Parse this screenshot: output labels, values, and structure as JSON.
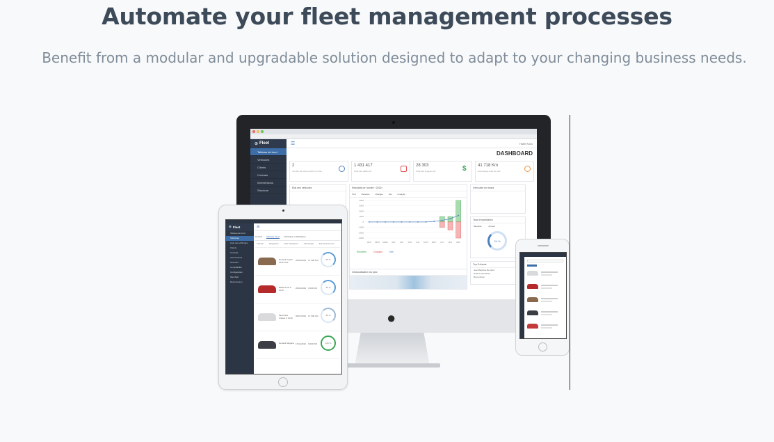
{
  "hero": {
    "title": "Automate your fleet management processes",
    "subtitle": "Benefit from a modular and upgradable solution designed to adapt to your changing business needs."
  },
  "desktop_app": {
    "logo": "Fleet",
    "page_title": "DASHBOARD",
    "user": "Hatte Karo",
    "sidebar": [
      "Tableau de bord",
      "Véhicules",
      "Clients",
      "Contrats",
      "Interventions",
      "Structure"
    ],
    "kpis": [
      {
        "value": "2",
        "label": "nombre de clients actifs ce mois",
        "icon": "users-icon",
        "color": "#4d7fbf"
      },
      {
        "value": "1 431 417",
        "label": "Total des débits HT",
        "icon": "card-icon",
        "color": "#e05252"
      },
      {
        "value": "28 303",
        "label": "Total des impayés HT",
        "icon": "dollar-icon",
        "color": "#3aa655"
      },
      {
        "value": "41 718 Km",
        "label": "kilométrage total du parc",
        "icon": "gauge-icon",
        "color": "#f0913a"
      }
    ],
    "panels": {
      "vehicle_state": "État des véhicules",
      "results": "Résultats de l'année",
      "returns": "Véhicules en retard",
      "occupancy": "Taux d'exploitation",
      "map": "Géolocalisation du parc",
      "top_clients": "Top 5 clients"
    },
    "results_tabs": [
      "Tout",
      "Recettes",
      "Charges",
      "Net",
      "Impayés"
    ],
    "results_year": "2016",
    "summary": [
      {
        "label": "Recettes",
        "color": "#3aa655"
      },
      {
        "label": "Charges",
        "color": "#e05252"
      },
      {
        "label": "Net",
        "color": "#4d7fbf"
      }
    ],
    "occupancy_value": "24 %",
    "occupancy_tabs": [
      "Mensuel",
      "Annuel"
    ],
    "top_clients": [
      "Jean-Baptiste Bernard",
      "Noël Goulet-Rose",
      "Bryce Morin"
    ]
  },
  "tablet_app": {
    "logo": "Fleet",
    "tabs": [
      "Contrat",
      "Véhicule loués",
      "Véhicules et Statistique"
    ],
    "sidebar": [
      "Tableau de bord",
      "Véhicules",
      "Liste des véhicules",
      "Clients",
      "Contrats",
      "Interventions",
      "Structure",
      "Comptabilité",
      "Configuration",
      "Site Web",
      "Déconnexion"
    ],
    "columns": [
      "Véhicule",
      "Désignation",
      "Date d'acquisition",
      "Kilométrage",
      "Etat d'avancement"
    ],
    "rows": [
      {
        "name": "Renault Captur 2019 TCE",
        "date": "20/03/2016",
        "km": "37 000 KM",
        "pct": "66 %",
        "car_color": "#8a6a4f",
        "ring_color": "#5b9bd5"
      },
      {
        "name": "BMW Série 5 2019",
        "date": "20/04/2016",
        "km": "3 000 KM",
        "pct": "55 %",
        "car_color": "#b52a2a",
        "ring_color": "#5b9bd5"
      },
      {
        "name": "Mercedes Classe C 2019",
        "date": "06/07/2016",
        "km": "27 000 KM",
        "pct": "35 %",
        "car_color": "#d9dadc",
        "ring_color": "#9bb8d6"
      },
      {
        "name": "Renault Mégane",
        "date": "17/11/2016",
        "km": "9 000 KM",
        "pct": "100 %",
        "car_color": "#3b3f45",
        "ring_color": "#3aa655"
      }
    ]
  },
  "phone_app": {
    "rows": [
      {
        "car_color": "#d9dadc"
      },
      {
        "car_color": "#b52a2a"
      },
      {
        "car_color": "#8a6a4f"
      },
      {
        "car_color": "#3b3f45"
      },
      {
        "car_color": "#c23a3a"
      }
    ]
  },
  "chart_data": {
    "type": "bar",
    "title": "Résultats de l'année",
    "categories": [
      "JANV",
      "FÉVR",
      "MARS",
      "AVR",
      "MAI",
      "JUIN",
      "JUIL",
      "AOÛT",
      "SEPT",
      "OCT",
      "NOV",
      "DÉC"
    ],
    "series": [
      {
        "name": "Recettes",
        "values": [
          0,
          0,
          0,
          0,
          0,
          0,
          0,
          0,
          0,
          1000,
          1000,
          4000
        ]
      },
      {
        "name": "Charges",
        "values": [
          0,
          0,
          0,
          0,
          0,
          0,
          0,
          0,
          0,
          -1000,
          -1500,
          -3000
        ]
      },
      {
        "name": "Net",
        "values": [
          0,
          0,
          0,
          0,
          0,
          0,
          0,
          0,
          100,
          300,
          600,
          1200
        ]
      }
    ],
    "yticks": [
      "4000",
      "3000",
      "2000",
      "1000",
      "0",
      "-1000",
      "-2000",
      "-3000"
    ],
    "ylim": [
      -3000,
      4000
    ]
  }
}
